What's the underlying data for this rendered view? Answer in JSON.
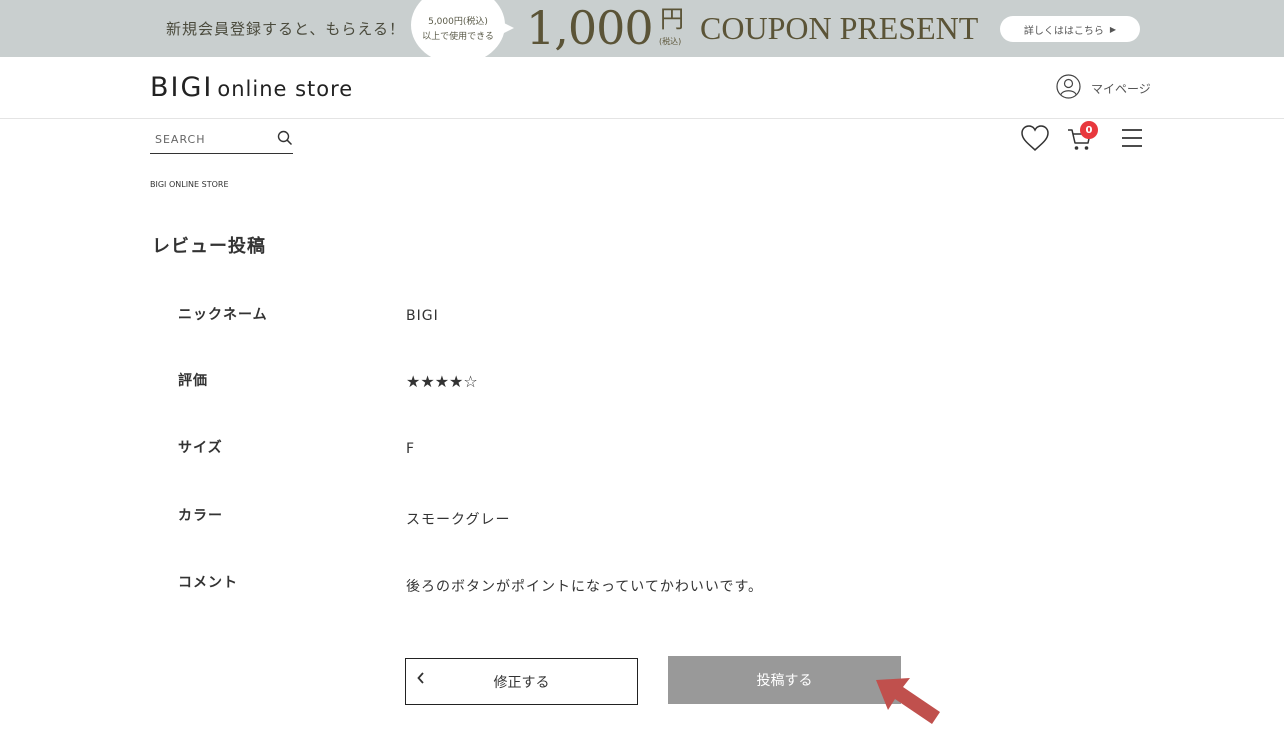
{
  "banner": {
    "lead_text": "新規会員登録すると、もらえる！",
    "bubble_line1": "5,000円(税込)",
    "bubble_line2": "以上で使用できる",
    "amount": "1,000",
    "yen": "円",
    "tax_note": "(税込)",
    "coupon_text": "COUPON PRESENT",
    "cta_label": "詳しくははこちら",
    "cta_arrow": "▶"
  },
  "header": {
    "logo_main": "BIGI",
    "logo_sub": "online store",
    "mypage_label": "マイページ"
  },
  "search": {
    "placeholder": "SEARCH"
  },
  "cart": {
    "count": "0",
    "badge_color": "#e8383d"
  },
  "icons": [
    "user-icon",
    "search-icon",
    "heart-icon",
    "cart-icon",
    "hamburger-menu-icon",
    "chevron-left-icon",
    "pointer-arrow-icon"
  ],
  "breadcrumb": "BIGI ONLINE STORE",
  "page_title": "レビュー投稿",
  "review": {
    "nickname_label": "ニックネーム",
    "nickname_value": "BIGI",
    "rating_label": "評価",
    "rating_display": "★★★★☆",
    "rating_value": 4,
    "rating_max": 5,
    "size_label": "サイズ",
    "size_value": "F",
    "color_label": "カラー",
    "color_value": "スモークグレー",
    "comment_label": "コメント",
    "comment_value": "後ろのボタンがポイントになっていてかわいいです。"
  },
  "buttons": {
    "edit_label": "修正する",
    "post_label": "投稿する",
    "post_color": "#999999"
  },
  "annotation": {
    "arrow_color": "#c0504d"
  }
}
